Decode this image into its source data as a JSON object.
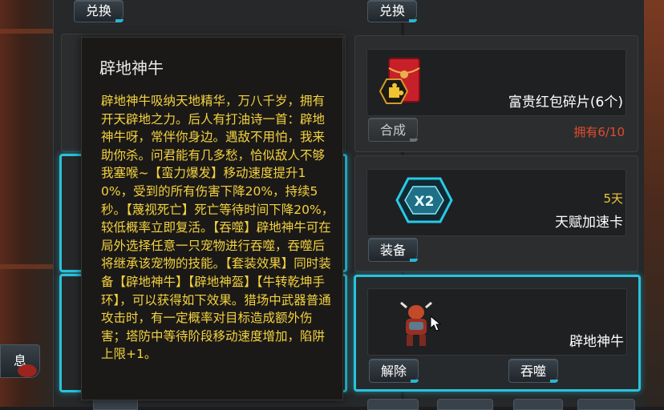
{
  "top_buttons": {
    "left_label": "兑换",
    "right_label": "兑换"
  },
  "tooltip": {
    "title": "辟地神牛",
    "description": "辟地神牛吸纳天地精华，万八千岁，拥有开天辟地之力。后人有打油诗一首：辟地神牛呀，常伴你身边。遇敌不用怕，我来助你杀。问君能有几多愁，恰似敌人不够我塞喉~【蛮力爆发】移动速度提升10%，受到的所有伤害下降20%，持续5秒。【蔑视死亡】死亡等待时间下降20%，较低概率立即复活。【吞噬】辟地神牛可在局外选择任意一只宠物进行吞噬，吞噬后将继承该宠物的技能。【套装效果】同时装备【辟地神牛】【辟地神盔】【牛转乾坤手环】，可以获得如下效果。猎场中武器普通攻击时，有一定概率对目标造成额外伤害；塔防中等待阶段移动速度增加，陷阱上限+1。"
  },
  "items": {
    "red_packet": {
      "name": "富贵红包碎片(6个)",
      "owned": "拥有6/10",
      "button": "合成",
      "icon": "red-packet-icon",
      "badge_icon": "puzzle-piece-icon"
    },
    "speed_card": {
      "name": "天赋加速卡",
      "days": "5天",
      "button": "装备",
      "icon": "x2-card-icon",
      "icon_text": "X2"
    },
    "pet": {
      "name": "辟地神牛",
      "button_left": "解除",
      "button_right": "吞噬",
      "icon": "pet-bull-icon"
    }
  },
  "left_edge": {
    "label": "息"
  },
  "colors": {
    "accent": "#29c3dc",
    "gold": "#f3d23f",
    "owned": "#e44b2d"
  }
}
